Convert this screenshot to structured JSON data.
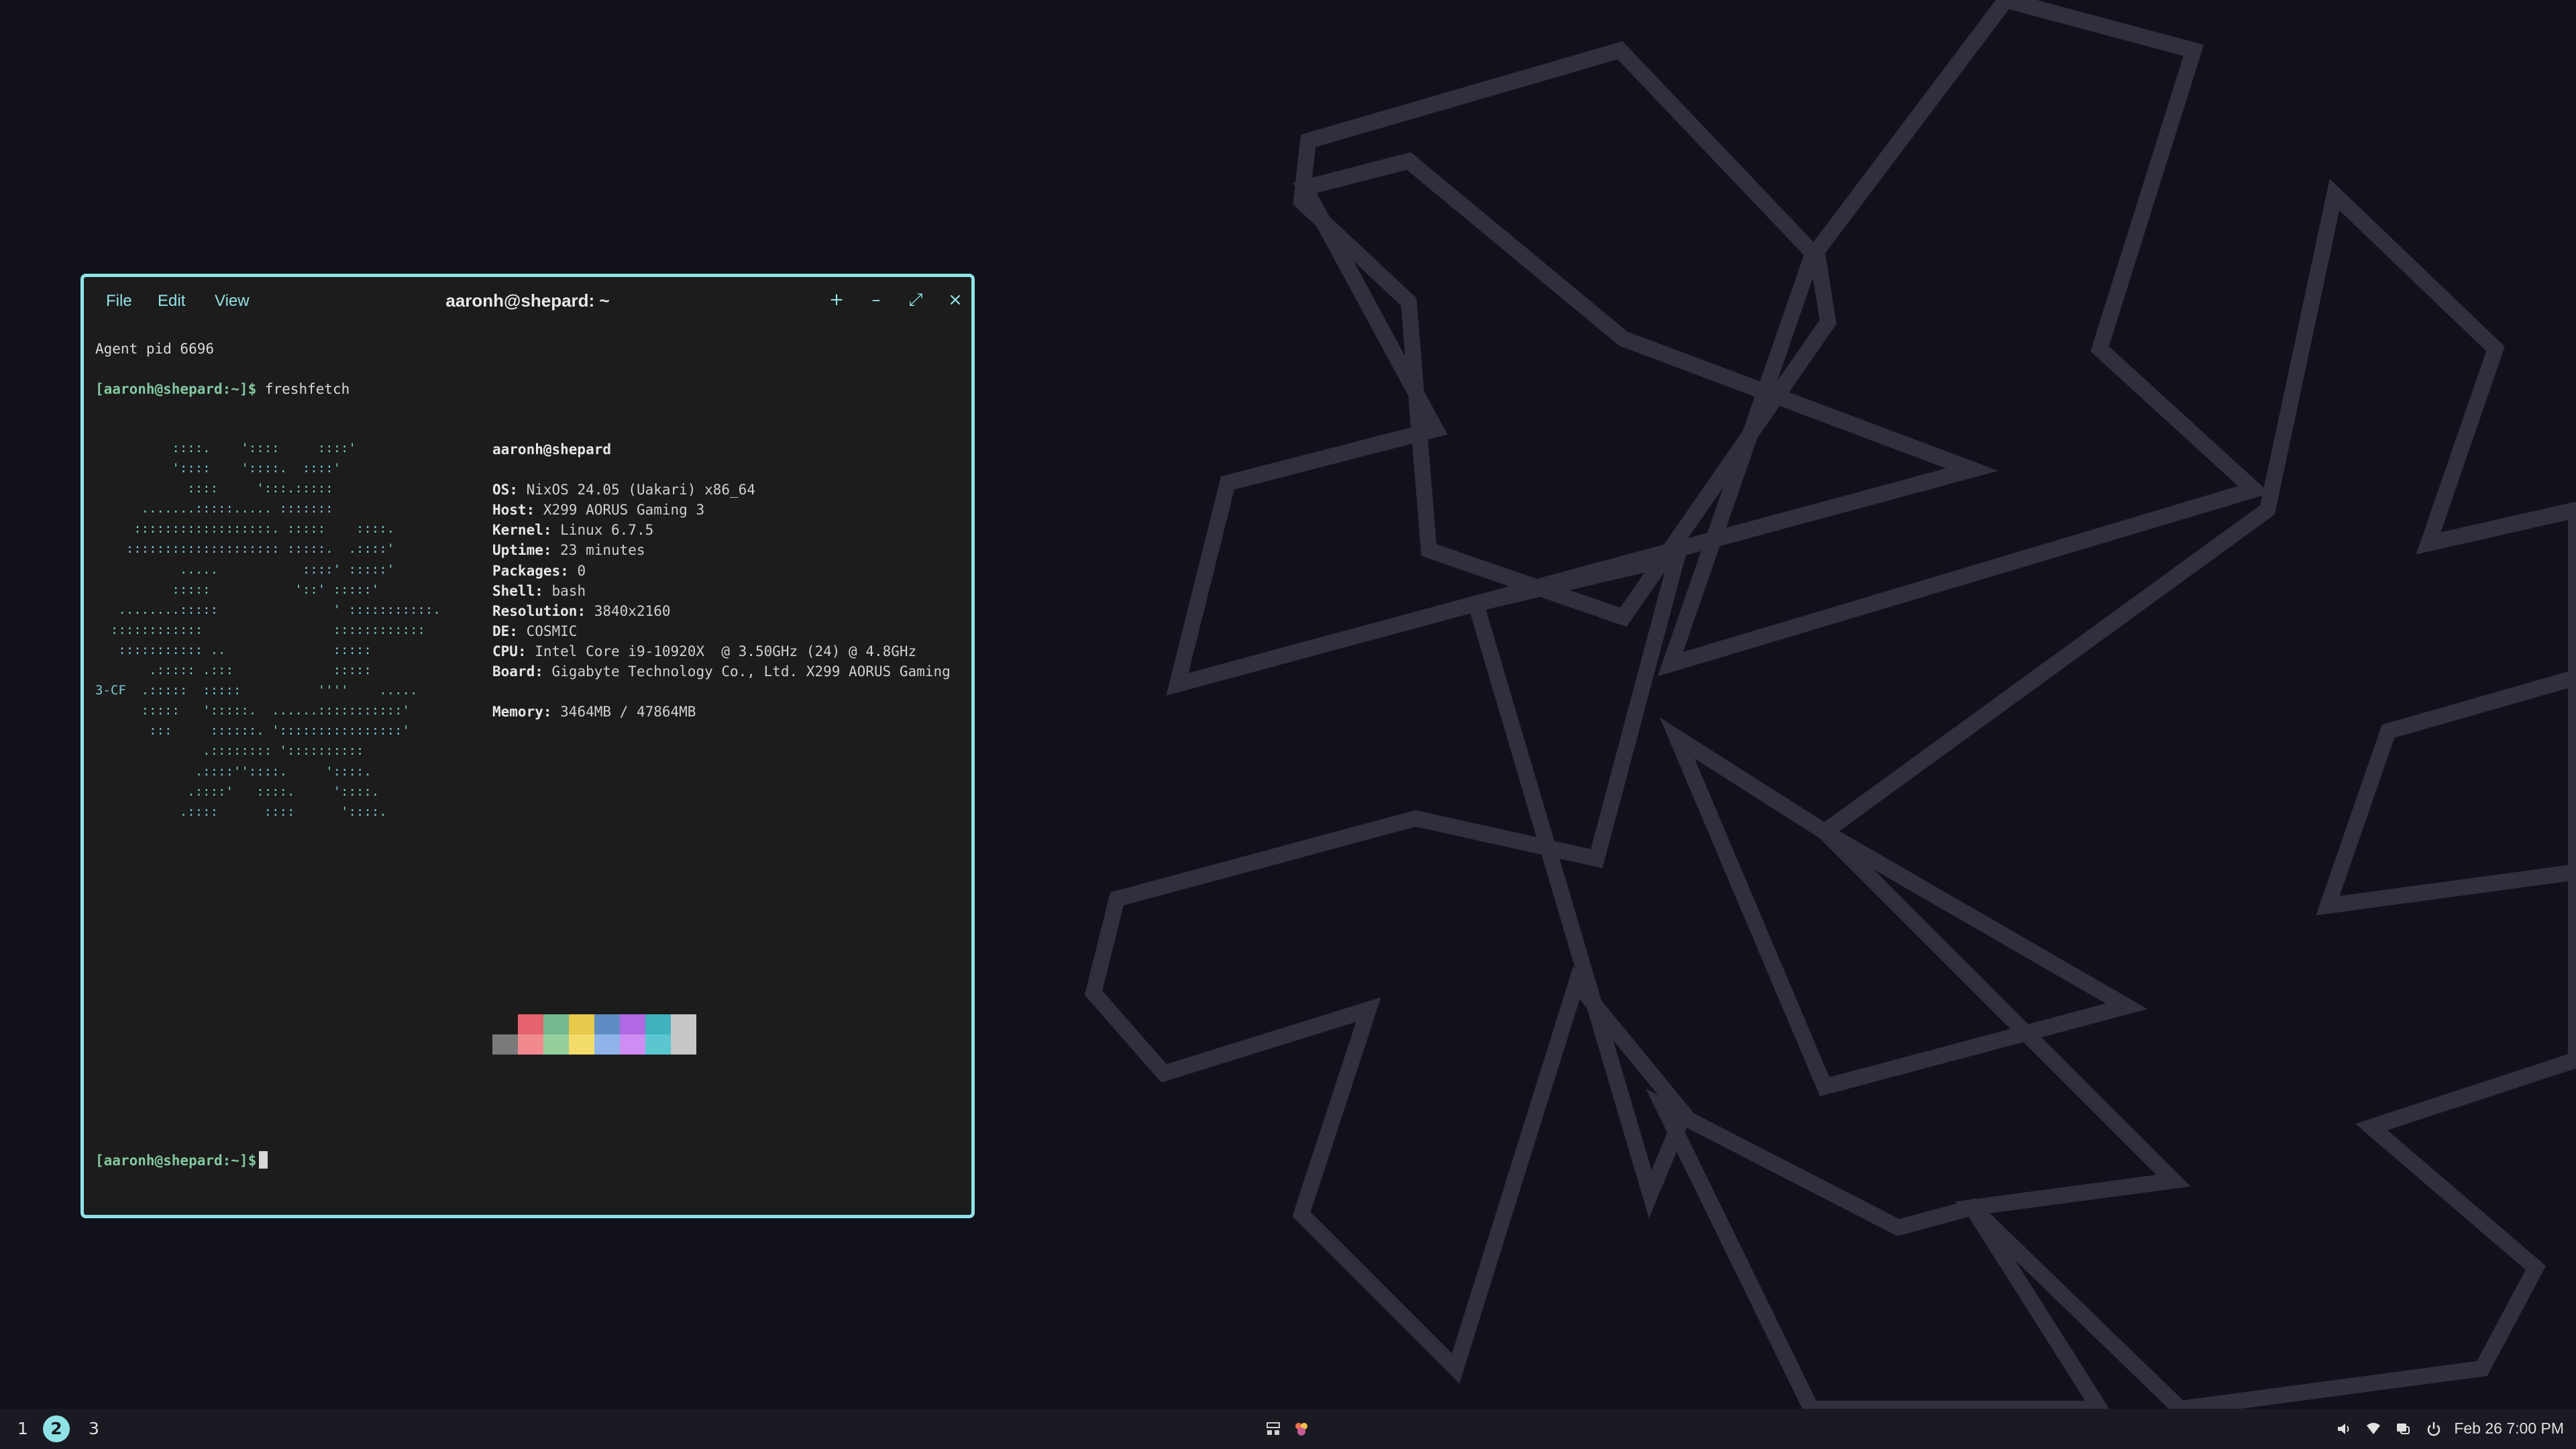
{
  "terminal": {
    "menu": [
      "File",
      "Edit",
      "View"
    ],
    "title": "aaronh@shepard: ~",
    "buttons": {
      "new_tab": "+",
      "minimize": "–",
      "maximize": "⤢",
      "close": "×"
    },
    "border_color": "#8fe3e7",
    "lines": {
      "agent": "Agent pid 6696",
      "prompt": "[aaronh@shepard:~]$",
      "command": "freshfetch",
      "prompt2": "[aaronh@shepard:~]$"
    },
    "ascii_art": "          ::::.    '::::     ::::'\n          '::::    '::::.  ::::'\n            ::::     ':::.:::::\n      .......:::::..... :::::::\n     ::::::::::::::::::. :::::    ::::.\n    :::::::::::::::::::: :::::.  .::::'\n           .....           ::::' :::::'\n          :::::           '::' :::::'\n   ........:::::               ' :::::::::::.\n  ::::::::::::                 ::::::::::::\n   ::::::::::: ..              :::::\n       .::::: .:::             :::::\n3-CF  .:::::  :::::          ''''    .....\n      :::::   ':::::.  ......:::::::::::'\n       :::     ::::::. '::::::::::::::::'\n              .:::::::: '::::::::::\n             .::::''::::.     '::::.\n            .::::'   ::::.     '::::.\n           .::::      ::::      '::::.",
    "info": {
      "user": "aaronh@shepard",
      "rows": [
        {
          "key": "OS",
          "value": "NixOS 24.05 (Uakari) x86_64"
        },
        {
          "key": "Host",
          "value": "X299 AORUS Gaming 3"
        },
        {
          "key": "Kernel",
          "value": "Linux 6.7.5"
        },
        {
          "key": "Uptime",
          "value": "23 minutes"
        },
        {
          "key": "Packages",
          "value": "0"
        },
        {
          "key": "Shell",
          "value": "bash"
        },
        {
          "key": "Resolution",
          "value": "3840x2160"
        },
        {
          "key": "DE",
          "value": "COSMIC"
        },
        {
          "key": "CPU",
          "value": "Intel Core i9-10920X  @ 3.50GHz (24) @ 4.8GHz"
        },
        {
          "key": "Board",
          "value": "Gigabyte Technology Co., Ltd. X299 AORUS Gaming"
        }
      ],
      "memory_key": "Memory",
      "memory_value": "3464MB / 47864MB"
    },
    "palette_top": [
      "#1c1c1c",
      "#e5636f",
      "#74b98f",
      "#e6c84a",
      "#5e8dc4",
      "#b068e3",
      "#3eb3be",
      "#c7c7c7"
    ],
    "palette_bottom": [
      "#7a7a7a",
      "#f08a8f",
      "#96cf9c",
      "#f3dc6b",
      "#8fb4ea",
      "#cd8df2",
      "#5bc6cf",
      "#c7c7c7"
    ]
  },
  "panel": {
    "workspaces": [
      "1",
      "2",
      "3"
    ],
    "active_workspace": "2",
    "clock": "Feb 26 7:00 PM",
    "accent": "#8fe3e7"
  }
}
